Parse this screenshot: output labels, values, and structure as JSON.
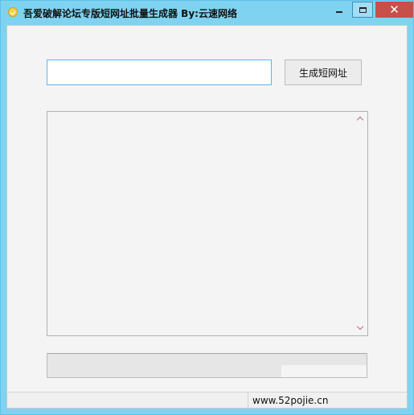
{
  "window": {
    "title": "吾爱破解论坛专版短网址批量生成器 By:云速网络",
    "controls": {
      "close_glyph": "✕"
    }
  },
  "form": {
    "url_input_value": "",
    "generate_button_label": "生成短网址"
  },
  "output": {
    "text": ""
  },
  "progress": {
    "percent": 0
  },
  "statusbar": {
    "site": "www.52pojie.cn"
  },
  "colors": {
    "titlebar": "#7fd3f0",
    "close_button": "#c7504a",
    "input_border": "#5fb4e6"
  }
}
